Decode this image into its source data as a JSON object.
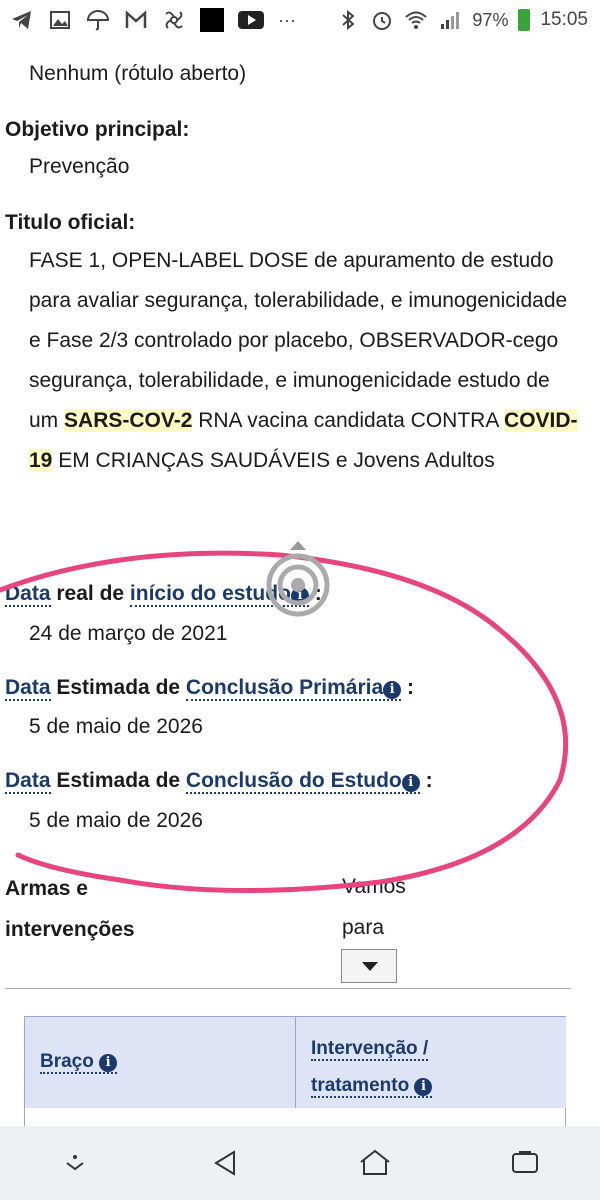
{
  "status_bar": {
    "icons": [
      "telegram-icon",
      "image-icon",
      "umbrella-icon",
      "gmail-icon",
      "pinwheel-icon",
      "black-square-icon",
      "youtube-icon",
      "more-icon"
    ],
    "more": "···",
    "battery": "97%",
    "time": "15:05"
  },
  "fields": {
    "masking_value": "Nenhum (rótulo aberto)",
    "objective_label": "Objetivo principal:",
    "objective_value": "Prevenção",
    "title_label": "Titulo oficial:",
    "title_text_1": "FASE 1, OPEN-LABEL DOSE de apuramento de estudo para avaliar segurança, tolerabilidade, e imunogenicidade e Fase 2/3 controlado por placebo, OBSERVADOR-cego segurança, tolerabilidade, e imunogenicidade estudo de um",
    "title_hl_1": "SARS-COV-2",
    "title_text_2": " RNA vacina candidata CONTRA ",
    "title_hl_2": "COVID- 19",
    "title_text_3": " EM CRIANÇAS SAUDÁVEIS e Jovens Adultos"
  },
  "dates": {
    "start_word": "Data",
    "start_mid": " real de ",
    "start_link": "início do estudo",
    "start_value": "24 de março de 2021",
    "primary_word": "Data",
    "primary_mid": " Estimada de ",
    "primary_link": "Conclusão Primária",
    "primary_value": "5 de maio de 2026",
    "study_word": "Data",
    "study_mid": " Estimada de ",
    "study_link": "Conclusão do Estudo",
    "study_value": "5 de maio de 2026",
    "colon": " :"
  },
  "arms": {
    "label_line1": "Armas e",
    "label_line2": "intervenções",
    "goto_line1": "Vamos",
    "goto_line2": "para"
  },
  "table": {
    "col1": "Braço",
    "col2_line1": "Intervenção /",
    "col2_line2": "tratamento"
  },
  "info_glyph": "i",
  "annotation_color": "#e8457f"
}
